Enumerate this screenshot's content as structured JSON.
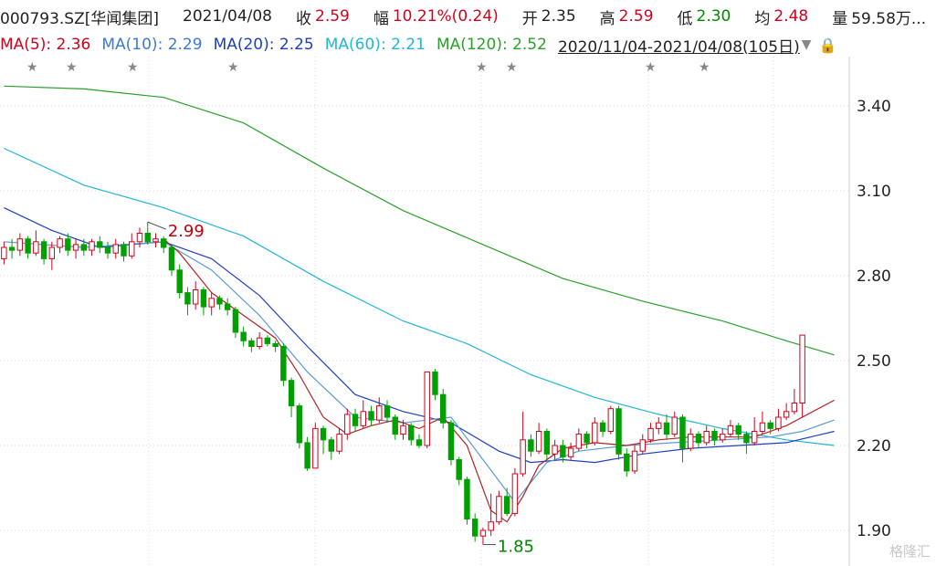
{
  "header": {
    "ticker": "000793.SZ[华闻集团]",
    "date": "2021/04/08",
    "close_label": "收",
    "close_value": "2.59",
    "change_label": "幅",
    "change_value": "10.21%(0.24)",
    "open_label": "开",
    "open_value": "2.35",
    "high_label": "高",
    "high_value": "2.59",
    "low_label": "低",
    "low_value": "2.30",
    "avg_label": "均",
    "avg_value": "2.48",
    "volume_label": "量",
    "volume_value": "59.58万..."
  },
  "ma_legend": {
    "ma5": "MA(5): 2.36",
    "ma10": "MA(10): 2.29",
    "ma20": "MA(20): 2.25",
    "ma60": "MA(60): 2.21",
    "ma120": "MA(120): 2.52",
    "range": "2020/11/04-2021/04/08(105日)"
  },
  "colors": {
    "up": "#d0021b",
    "down": "#00a000",
    "ma5": "#b22222",
    "ma10": "#5b9bd5",
    "ma20": "#1f3fbf",
    "ma60": "#22b5d8",
    "ma120": "#2aa02a",
    "grid": "#d8d8d8"
  },
  "chart_data": {
    "type": "candlestick",
    "yticks": [
      "3.40",
      "3.10",
      "2.80",
      "2.50",
      "2.20",
      "1.90"
    ],
    "ylim": [
      1.85,
      3.55
    ],
    "annotations": [
      {
        "label": "2.99",
        "type": "max"
      },
      {
        "label": "1.85",
        "type": "min"
      }
    ],
    "star_markers": 8,
    "candles": [
      [
        2.86,
        2.9,
        2.92,
        2.84
      ],
      [
        2.9,
        2.89,
        2.93,
        2.86
      ],
      [
        2.89,
        2.93,
        2.95,
        2.87
      ],
      [
        2.93,
        2.88,
        2.94,
        2.86
      ],
      [
        2.88,
        2.92,
        2.96,
        2.87
      ],
      [
        2.92,
        2.86,
        2.93,
        2.84
      ],
      [
        2.86,
        2.9,
        2.92,
        2.82
      ],
      [
        2.9,
        2.93,
        2.94,
        2.88
      ],
      [
        2.93,
        2.89,
        2.95,
        2.87
      ],
      [
        2.89,
        2.91,
        2.93,
        2.86
      ],
      [
        2.91,
        2.89,
        2.93,
        2.87
      ],
      [
        2.89,
        2.92,
        2.93,
        2.87
      ],
      [
        2.92,
        2.9,
        2.94,
        2.88
      ],
      [
        2.9,
        2.88,
        2.92,
        2.86
      ],
      [
        2.88,
        2.91,
        2.93,
        2.86
      ],
      [
        2.91,
        2.87,
        2.92,
        2.85
      ],
      [
        2.87,
        2.92,
        2.95,
        2.86
      ],
      [
        2.92,
        2.95,
        2.97,
        2.9
      ],
      [
        2.95,
        2.92,
        2.99,
        2.91
      ],
      [
        2.92,
        2.93,
        2.95,
        2.9
      ],
      [
        2.93,
        2.9,
        2.94,
        2.88
      ],
      [
        2.9,
        2.82,
        2.91,
        2.8
      ],
      [
        2.82,
        2.74,
        2.84,
        2.72
      ],
      [
        2.74,
        2.7,
        2.76,
        2.66
      ],
      [
        2.7,
        2.75,
        2.78,
        2.68
      ],
      [
        2.75,
        2.69,
        2.76,
        2.66
      ],
      [
        2.69,
        2.72,
        2.74,
        2.66
      ],
      [
        2.72,
        2.7,
        2.73,
        2.68
      ],
      [
        2.7,
        2.68,
        2.72,
        2.66
      ],
      [
        2.68,
        2.6,
        2.69,
        2.58
      ],
      [
        2.6,
        2.57,
        2.62,
        2.55
      ],
      [
        2.57,
        2.55,
        2.58,
        2.53
      ],
      [
        2.55,
        2.58,
        2.6,
        2.54
      ],
      [
        2.58,
        2.56,
        2.59,
        2.55
      ],
      [
        2.56,
        2.55,
        2.57,
        2.53
      ],
      [
        2.55,
        2.43,
        2.56,
        2.41
      ],
      [
        2.43,
        2.34,
        2.44,
        2.3
      ],
      [
        2.34,
        2.21,
        2.35,
        2.19
      ],
      [
        2.21,
        2.12,
        2.23,
        2.11
      ],
      [
        2.12,
        2.26,
        2.28,
        2.12
      ],
      [
        2.26,
        2.22,
        2.27,
        2.17
      ],
      [
        2.22,
        2.18,
        2.23,
        2.15
      ],
      [
        2.18,
        2.24,
        2.26,
        2.17
      ],
      [
        2.24,
        2.31,
        2.33,
        2.22
      ],
      [
        2.31,
        2.27,
        2.33,
        2.25
      ],
      [
        2.27,
        2.32,
        2.36,
        2.26
      ],
      [
        2.32,
        2.29,
        2.34,
        2.27
      ],
      [
        2.29,
        2.34,
        2.37,
        2.28
      ],
      [
        2.34,
        2.3,
        2.36,
        2.28
      ],
      [
        2.3,
        2.24,
        2.31,
        2.22
      ],
      [
        2.24,
        2.27,
        2.29,
        2.22
      ],
      [
        2.27,
        2.22,
        2.28,
        2.2
      ],
      [
        2.22,
        2.2,
        2.24,
        2.19
      ],
      [
        2.2,
        2.46,
        2.46,
        2.19
      ],
      [
        2.46,
        2.38,
        2.47,
        2.36
      ],
      [
        2.38,
        2.28,
        2.4,
        2.26
      ],
      [
        2.28,
        2.15,
        2.29,
        2.13
      ],
      [
        2.15,
        2.08,
        2.16,
        2.06
      ],
      [
        2.08,
        1.94,
        2.09,
        1.92
      ],
      [
        1.94,
        1.88,
        1.96,
        1.86
      ],
      [
        1.88,
        1.9,
        1.91,
        1.85
      ],
      [
        1.9,
        1.93,
        2.03,
        1.88
      ],
      [
        1.93,
        2.02,
        2.04,
        1.92
      ],
      [
        2.02,
        1.96,
        2.05,
        1.95
      ],
      [
        1.96,
        2.1,
        2.12,
        1.95
      ],
      [
        2.1,
        2.22,
        2.32,
        2.09
      ],
      [
        2.22,
        2.18,
        2.24,
        2.16
      ],
      [
        2.18,
        2.25,
        2.28,
        2.17
      ],
      [
        2.25,
        2.17,
        2.26,
        2.15
      ],
      [
        2.17,
        2.2,
        2.22,
        2.15
      ],
      [
        2.2,
        2.16,
        2.22,
        2.14
      ],
      [
        2.16,
        2.19,
        2.21,
        2.15
      ],
      [
        2.19,
        2.24,
        2.26,
        2.18
      ],
      [
        2.24,
        2.21,
        2.25,
        2.19
      ],
      [
        2.21,
        2.28,
        2.3,
        2.2
      ],
      [
        2.28,
        2.25,
        2.29,
        2.23
      ],
      [
        2.25,
        2.33,
        2.34,
        2.24
      ],
      [
        2.33,
        2.17,
        2.34,
        2.15
      ],
      [
        2.17,
        2.11,
        2.19,
        2.09
      ],
      [
        2.11,
        2.18,
        2.2,
        2.1
      ],
      [
        2.18,
        2.22,
        2.24,
        2.17
      ],
      [
        2.22,
        2.26,
        2.28,
        2.21
      ],
      [
        2.26,
        2.28,
        2.3,
        2.24
      ],
      [
        2.28,
        2.24,
        2.31,
        2.22
      ],
      [
        2.24,
        2.3,
        2.32,
        2.23
      ],
      [
        2.3,
        2.19,
        2.31,
        2.14
      ],
      [
        2.19,
        2.24,
        2.26,
        2.18
      ],
      [
        2.24,
        2.21,
        2.25,
        2.19
      ],
      [
        2.21,
        2.25,
        2.27,
        2.2
      ],
      [
        2.25,
        2.22,
        2.26,
        2.2
      ],
      [
        2.22,
        2.24,
        2.26,
        2.21
      ],
      [
        2.24,
        2.27,
        2.29,
        2.23
      ],
      [
        2.27,
        2.24,
        2.28,
        2.22
      ],
      [
        2.24,
        2.21,
        2.25,
        2.17
      ],
      [
        2.21,
        2.25,
        2.3,
        2.2
      ],
      [
        2.25,
        2.28,
        2.32,
        2.24
      ],
      [
        2.28,
        2.26,
        2.29,
        2.24
      ],
      [
        2.26,
        2.3,
        2.33,
        2.25
      ],
      [
        2.3,
        2.32,
        2.35,
        2.29
      ],
      [
        2.32,
        2.35,
        2.4,
        2.31
      ],
      [
        2.35,
        2.59,
        2.59,
        2.3
      ]
    ],
    "ma_series": {
      "ma5": {
        "start": [
          20,
          2.93
        ],
        "points": [
          [
            22,
            2.88
          ],
          [
            26,
            2.74
          ],
          [
            30,
            2.66
          ],
          [
            34,
            2.58
          ],
          [
            37,
            2.45
          ],
          [
            40,
            2.3
          ],
          [
            43,
            2.24
          ],
          [
            46,
            2.27
          ],
          [
            49,
            2.29
          ],
          [
            52,
            2.26
          ],
          [
            55,
            2.3
          ],
          [
            58,
            2.2
          ],
          [
            61,
            1.97
          ],
          [
            63,
            1.93
          ],
          [
            65,
            2.02
          ],
          [
            67,
            2.13
          ],
          [
            70,
            2.19
          ],
          [
            74,
            2.21
          ],
          [
            78,
            2.2
          ],
          [
            82,
            2.22
          ],
          [
            86,
            2.23
          ],
          [
            90,
            2.23
          ],
          [
            94,
            2.23
          ],
          [
            98,
            2.27
          ],
          [
            100,
            2.3
          ],
          [
            104,
            2.36
          ]
        ]
      },
      "ma10": {
        "start": [
          0,
          2.92
        ],
        "points": [
          [
            10,
            2.9
          ],
          [
            20,
            2.92
          ],
          [
            26,
            2.82
          ],
          [
            32,
            2.66
          ],
          [
            38,
            2.46
          ],
          [
            44,
            2.3
          ],
          [
            50,
            2.28
          ],
          [
            56,
            2.3
          ],
          [
            60,
            2.15
          ],
          [
            64,
            2.0
          ],
          [
            68,
            2.14
          ],
          [
            72,
            2.18
          ],
          [
            78,
            2.2
          ],
          [
            84,
            2.21
          ],
          [
            90,
            2.22
          ],
          [
            96,
            2.23
          ],
          [
            100,
            2.25
          ],
          [
            104,
            2.29
          ]
        ]
      },
      "ma20": {
        "start": [
          0,
          3.04
        ],
        "points": [
          [
            6,
            2.96
          ],
          [
            12,
            2.9
          ],
          [
            20,
            2.92
          ],
          [
            26,
            2.86
          ],
          [
            32,
            2.73
          ],
          [
            38,
            2.55
          ],
          [
            44,
            2.38
          ],
          [
            50,
            2.32
          ],
          [
            56,
            2.28
          ],
          [
            62,
            2.18
          ],
          [
            66,
            2.14
          ],
          [
            70,
            2.15
          ],
          [
            74,
            2.14
          ],
          [
            80,
            2.17
          ],
          [
            86,
            2.19
          ],
          [
            92,
            2.2
          ],
          [
            98,
            2.21
          ],
          [
            104,
            2.25
          ]
        ]
      },
      "ma60": {
        "start": [
          0,
          3.25
        ],
        "points": [
          [
            10,
            3.12
          ],
          [
            20,
            3.04
          ],
          [
            30,
            2.94
          ],
          [
            40,
            2.78
          ],
          [
            50,
            2.64
          ],
          [
            58,
            2.56
          ],
          [
            66,
            2.45
          ],
          [
            74,
            2.37
          ],
          [
            82,
            2.31
          ],
          [
            90,
            2.26
          ],
          [
            98,
            2.22
          ],
          [
            104,
            2.2
          ]
        ]
      },
      "ma120": {
        "start": [
          0,
          3.47
        ],
        "points": [
          [
            10,
            3.46
          ],
          [
            20,
            3.43
          ],
          [
            30,
            3.34
          ],
          [
            40,
            3.18
          ],
          [
            50,
            3.03
          ],
          [
            60,
            2.91
          ],
          [
            70,
            2.79
          ],
          [
            80,
            2.71
          ],
          [
            90,
            2.64
          ],
          [
            98,
            2.57
          ],
          [
            104,
            2.52
          ]
        ]
      }
    }
  },
  "watermark": "格隆汇"
}
